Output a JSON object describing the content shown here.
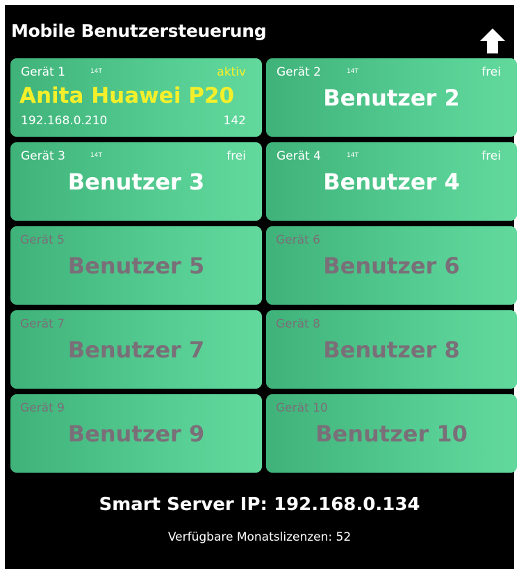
{
  "header": {
    "title": "Mobile Benutzersteuerung",
    "up_icon": "arrow-up-icon"
  },
  "tiles": [
    {
      "device": "Gerät 1",
      "tag": "14T",
      "status": "aktiv",
      "user": "Anita Huawei P20",
      "ip": "192.168.0.210",
      "count": "142"
    },
    {
      "device": "Gerät 2",
      "tag": "14T",
      "status": "frei",
      "user": "Benutzer 2"
    },
    {
      "device": "Gerät 3",
      "tag": "14T",
      "status": "frei",
      "user": "Benutzer 3"
    },
    {
      "device": "Gerät 4",
      "tag": "14T",
      "status": "frei",
      "user": "Benutzer 4"
    },
    {
      "device": "Gerät 5",
      "user": "Benutzer 5"
    },
    {
      "device": "Gerät 6",
      "user": "Benutzer 6"
    },
    {
      "device": "Gerät 7",
      "user": "Benutzer 7"
    },
    {
      "device": "Gerät 8",
      "user": "Benutzer 8"
    },
    {
      "device": "Gerät 9",
      "user": "Benutzer 9"
    },
    {
      "device": "Gerät 10",
      "user": "Benutzer 10"
    }
  ],
  "footer": {
    "server_ip": "Smart Server IP: 192.168.0.134",
    "licenses": "Verfügbare Monatslizenzen: 52"
  },
  "colors": {
    "background": "#000000",
    "tile": "#52c98d",
    "active_text": "#f4ef2b",
    "inactive_text": "#7a6f78"
  }
}
